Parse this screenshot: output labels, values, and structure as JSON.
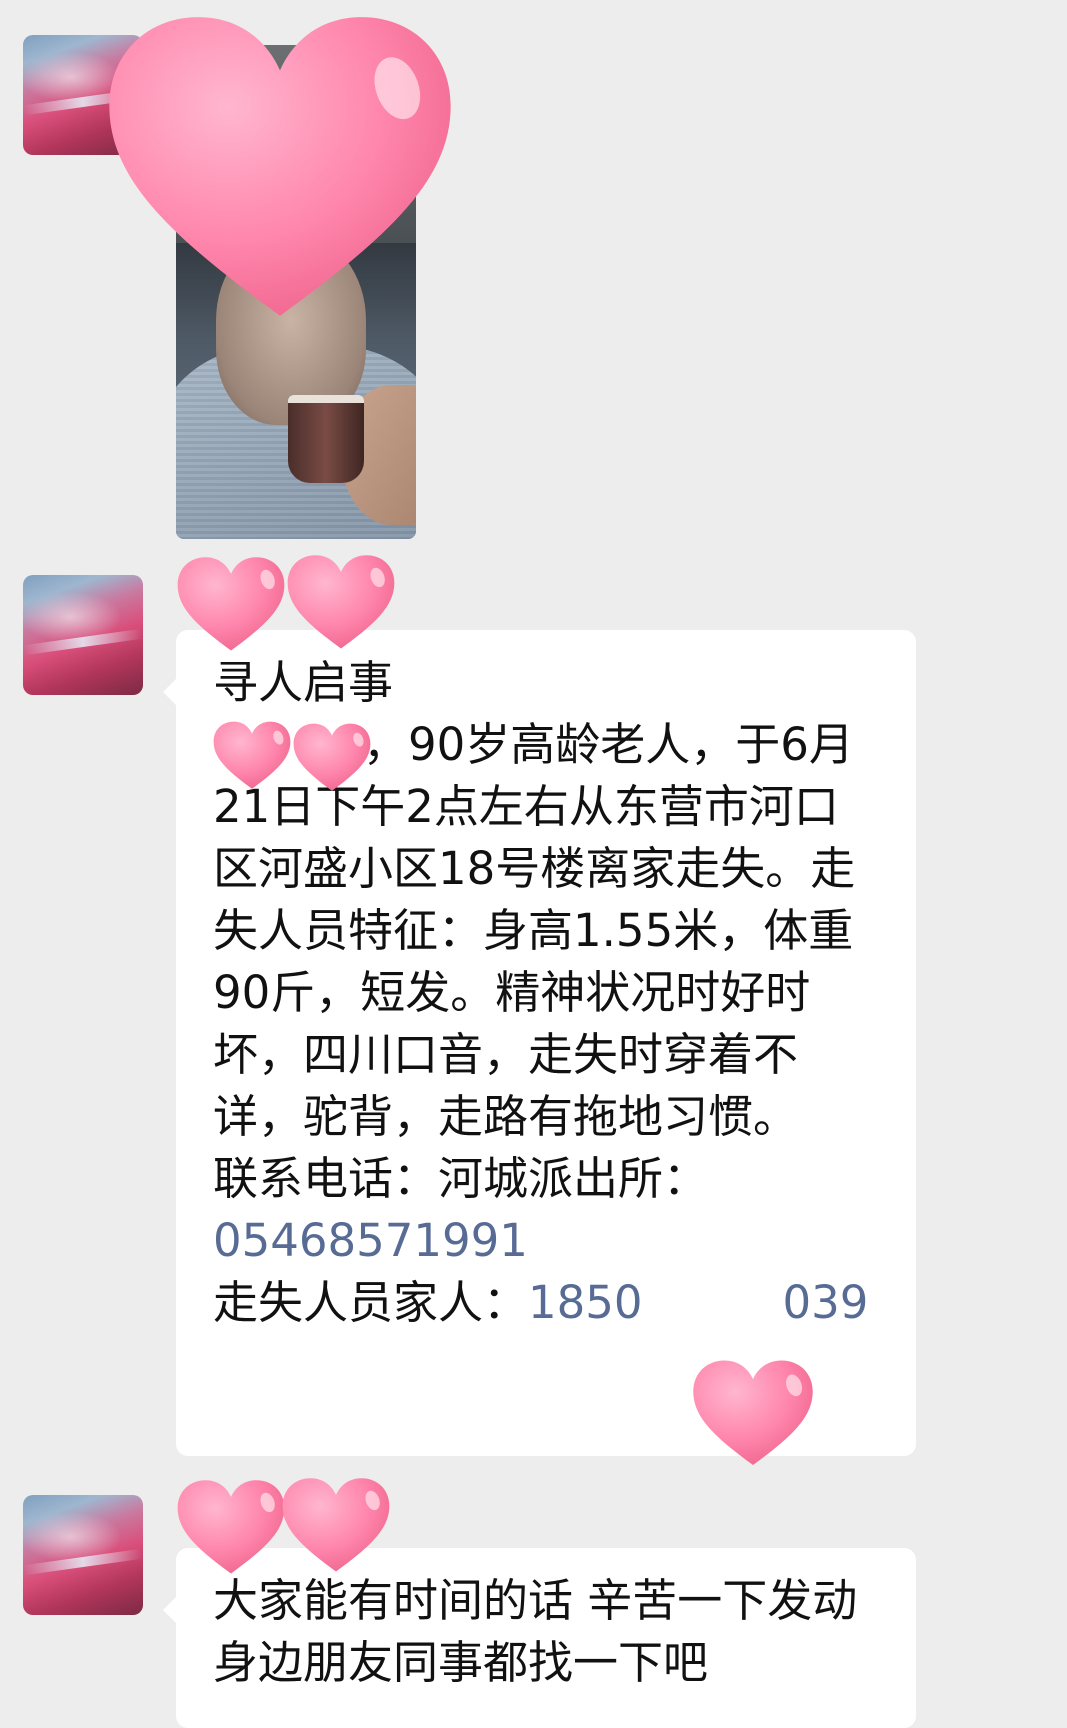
{
  "messages": [
    {
      "type": "image",
      "sender_avatar": "avatar-image",
      "description_hidden": true
    },
    {
      "type": "text",
      "title": "寻人启事",
      "body_start": "，90岁高龄老人，于6月21日下午2点左右从东营市河口区河盛小区18号楼离家走失。走失人员特征：身高1.55米，体重90斤，短发。精神状况时好时坏，四川口音，走失时穿着不详，驼背，走路有拖地习惯。",
      "contact_label": "联系电话：河城派出所：",
      "police_phone": "05468571991",
      "family_label": "走失人员家人：",
      "family_phone_start": "1850",
      "family_phone_end": "039"
    },
    {
      "type": "text",
      "body": "大家能有时间的话 辛苦一下发动身边朋友同事都找一下吧"
    }
  ],
  "colors": {
    "background": "#ededed",
    "bubble": "#ffffff",
    "link": "#576b95",
    "heart": "#ff7fa8"
  },
  "icons": [
    "heart-sticker-icon"
  ]
}
